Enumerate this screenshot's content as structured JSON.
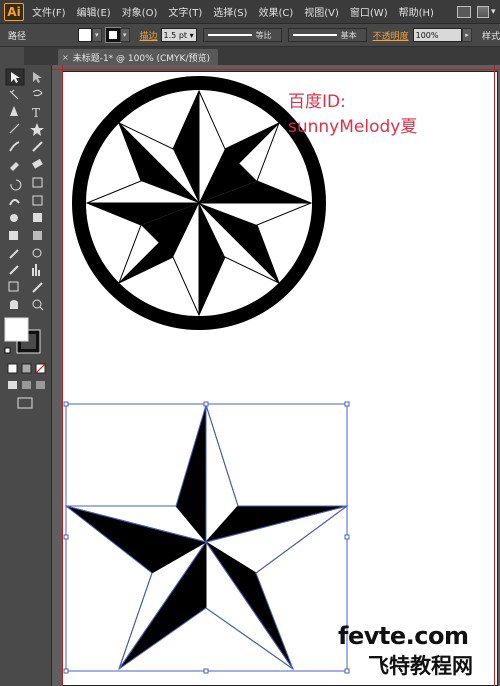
{
  "app": {
    "logo": "Ai"
  },
  "menu": [
    "文件(F)",
    "编辑(E)",
    "对象(O)",
    "文字(T)",
    "选择(S)",
    "效果(C)",
    "视图(V)",
    "窗口(W)",
    "帮助(H)"
  ],
  "controlbar": {
    "selection_label": "路径",
    "stroke_label": "描边",
    "stroke_weight": "1.5 pt",
    "profile_label": "等比",
    "brush_label": "基本",
    "opacity_label": "不透明度",
    "opacity_value": "100%",
    "style_label": "样式"
  },
  "tab": {
    "close": "×",
    "title": "未标题-1* @ 100% (CMYK/预览)"
  },
  "watermark": {
    "line1": "百度ID:",
    "line2": "sunnyMelody夏"
  },
  "site": {
    "domain": "fevte.com",
    "name": "飞特教程网"
  },
  "colors": {
    "accent": "#f2a23a",
    "watermark": "#e0304a",
    "selection": "#4a62c4"
  }
}
